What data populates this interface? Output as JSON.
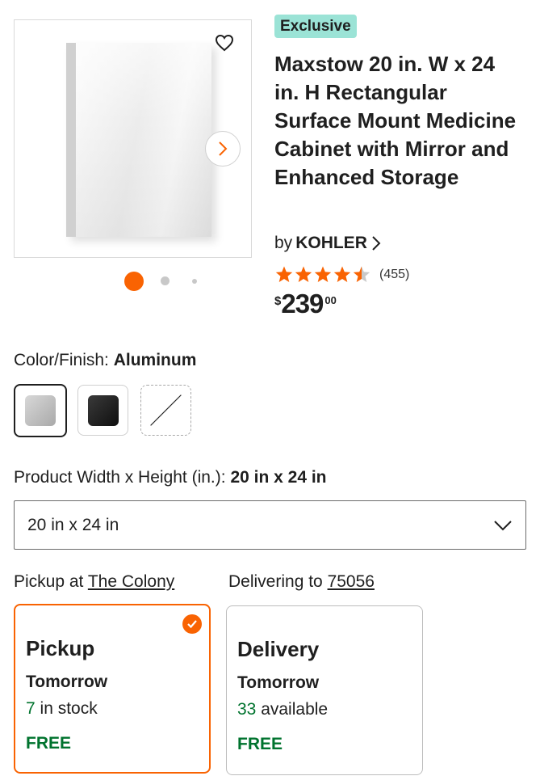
{
  "product": {
    "badge": "Exclusive",
    "title": "Maxstow 20 in. W x 24 in. H Rectangular Surface Mount Medicine Cabinet with Mirror and Enhanced Storage",
    "brand_prefix": "by",
    "brand": "KOHLER",
    "rating": 4.5,
    "rating_max": 5,
    "review_count": "(455)",
    "price": {
      "currency": "$",
      "dollars": "239",
      "cents": "00"
    }
  },
  "gallery": {
    "image_icon": "medicine-cabinet-image",
    "favorite_icon": "heart-icon",
    "next_icon": "chevron-right-icon",
    "dots_count": 3,
    "active_dot": 1
  },
  "color_finish": {
    "label": "Color/Finish:",
    "selected": "Aluminum",
    "swatches": [
      {
        "name": "Aluminum",
        "color": "#b8b8b8"
      },
      {
        "name": "Black",
        "color": "#1e1e1e"
      },
      {
        "name": "Unavailable",
        "color": "#ffffff"
      }
    ]
  },
  "size": {
    "label": "Product Width x Height (in.):",
    "selected": "20 in x 24 in",
    "dropdown_value": "20 in x 24 in"
  },
  "fulfillment": {
    "pickup_prefix": "Pickup at",
    "pickup_store": "The Colony",
    "delivery_prefix": "Delivering to",
    "delivery_zip": "75056",
    "pickup_card": {
      "title": "Pickup",
      "when": "Tomorrow",
      "count": "7",
      "count_suffix": "in stock",
      "price": "FREE"
    },
    "delivery_card": {
      "title": "Delivery",
      "when": "Tomorrow",
      "count": "33",
      "count_suffix": "available",
      "price": "FREE"
    }
  },
  "colors": {
    "accent": "#f96302",
    "badge_bg": "#9be3d6",
    "success": "#00732e",
    "star": "#f96302"
  }
}
